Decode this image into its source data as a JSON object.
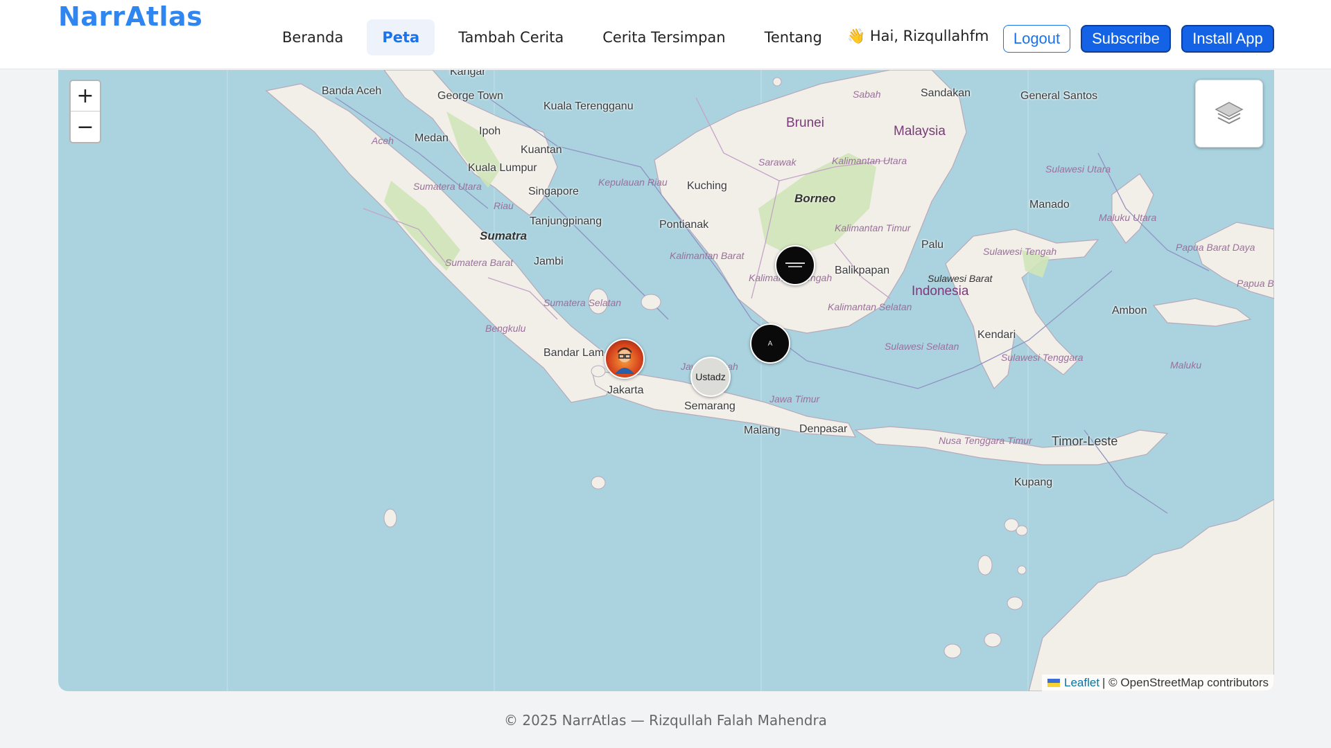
{
  "brand": "NarrAtlas",
  "nav": {
    "items": [
      {
        "label": "Beranda"
      },
      {
        "label": "Peta"
      },
      {
        "label": "Tambah Cerita"
      },
      {
        "label": "Cerita Tersimpan"
      },
      {
        "label": "Tentang"
      }
    ],
    "active": "Peta"
  },
  "user": {
    "greeting": "👋 Hai, Rizqullahfm",
    "logout_label": "Logout",
    "subscribe_label": "Subscribe",
    "install_label": "Install App"
  },
  "map": {
    "zoom_in": "+",
    "zoom_out": "−",
    "places": [
      "Banda Aceh",
      "Medan",
      "George Town",
      "Kangar",
      "Ipoh",
      "Kuala Terengganu",
      "Kuantan",
      "Kuala Lumpur",
      "Singapore",
      "Tanjungpinang",
      "Jambi",
      "Bandar Lam",
      "Jakarta",
      "Semarang",
      "Malang",
      "Denpasar",
      "Kuching",
      "Pontianak",
      "Balikpapan",
      "Sandakan",
      "General Santos",
      "Manado",
      "Palu",
      "Kendari",
      "Ambon",
      "Kupang",
      "Timor-Leste",
      "Indonesia",
      "Brunei",
      "Malaysia"
    ],
    "islands": [
      "Sumatra",
      "Borneo"
    ],
    "regions": [
      "Aceh",
      "Sumatera Utara",
      "Riau",
      "Kepulauan Riau",
      "Sumatera Barat",
      "Sumatera Selatan",
      "Bengkulu",
      "Kalimantan Barat",
      "Kalimantan Tengah",
      "Kalimantan Selatan",
      "Kalimantan Timur",
      "Kalimantan Utara",
      "Sarawak",
      "Sabah",
      "Sulawesi Utara",
      "Sulawesi Tengah",
      "Sulawesi Barat",
      "Sulawesi Selatan",
      "Sulawesi Tenggara",
      "Maluku Utara",
      "Maluku",
      "Papua Barat Daya",
      "Papua B",
      "Jawa Timur",
      "Jawa Tengah",
      "Nusa Tenggara Timur"
    ],
    "markers": [
      {
        "name": "story-marker-kalteng",
        "text": ""
      },
      {
        "name": "story-marker-java-sea",
        "text": "A"
      },
      {
        "name": "story-marker-avatar",
        "text": ""
      },
      {
        "name": "story-marker-ustadz",
        "text": "Ustadz"
      }
    ],
    "attribution": {
      "leaflet": "Leaflet",
      "osm": "| © OpenStreetMap contributors"
    }
  },
  "footer": "© 2025 NarrAtlas — Rizqullah Falah Mahendra",
  "colors": {
    "brand": "#2f86f0",
    "primary_button": "#1463e6",
    "sea": "#aad3df",
    "land": "#f2efe9"
  }
}
